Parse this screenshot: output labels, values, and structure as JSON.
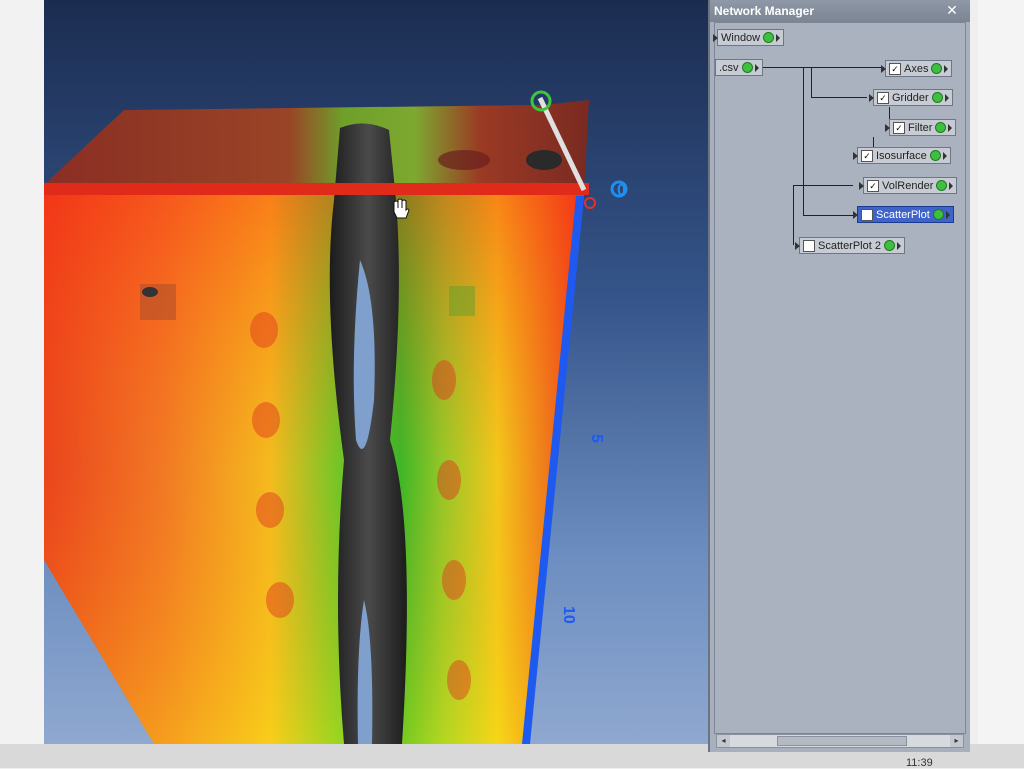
{
  "viewport": {
    "axis_label_top": "0",
    "axis_tick_5": "5",
    "axis_tick_10": "10"
  },
  "network_manager": {
    "title": "Network Manager",
    "close_glyph": "✕",
    "nodes": {
      "window": {
        "label": "Window"
      },
      "csv": {
        "label": ".csv"
      },
      "axes": {
        "label": "Axes",
        "checked": true
      },
      "gridder": {
        "label": "Gridder",
        "checked": true
      },
      "filter": {
        "label": "Filter",
        "checked": true
      },
      "isosurface": {
        "label": "Isosurface",
        "checked": true
      },
      "volrender": {
        "label": "VolRender",
        "checked": true
      },
      "scatterplot": {
        "label": "ScatterPlot",
        "checked": false,
        "selected": true
      },
      "scatterplot2": {
        "label": "ScatterPlot 2",
        "checked": false
      }
    },
    "scroll_left": "◂",
    "scroll_right": "▸"
  },
  "taskbar": {
    "clock": "11:39"
  },
  "colors": {
    "node_port": "#3fbf3f",
    "selected": "#3f63c8",
    "heat_high": "#e8321e",
    "heat_mid": "#f2e21a",
    "heat_low": "#22c22a",
    "isosurface": "#2e2e2e",
    "axis_z": "#1e5af0"
  }
}
